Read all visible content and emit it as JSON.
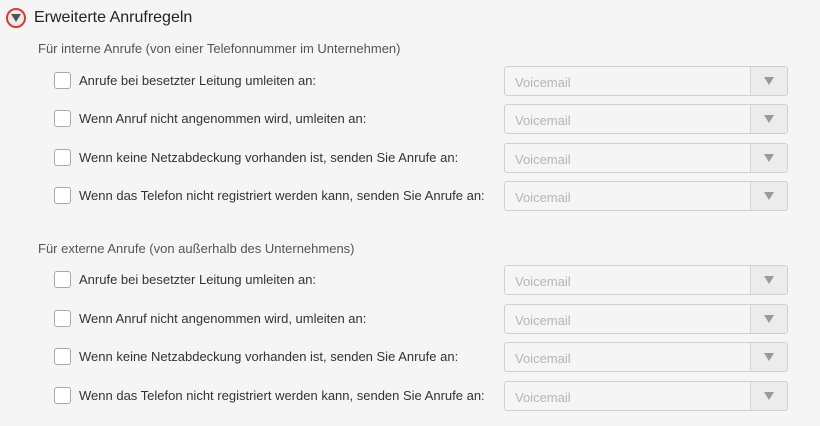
{
  "header": {
    "title": "Erweiterte Anrufregeln",
    "toggle_icon": "triangle-down-icon"
  },
  "internal": {
    "title": "Für interne Anrufe (von einer Telefonnummer im Unternehmen)",
    "rules": [
      {
        "label": "Anrufe bei besetzter Leitung umleiten an:",
        "checked": false,
        "value": "Voicemail"
      },
      {
        "label": "Wenn Anruf nicht angenommen wird, umleiten an:",
        "checked": false,
        "value": "Voicemail"
      },
      {
        "label": "Wenn keine Netzabdeckung vorhanden ist, senden Sie Anrufe an:",
        "checked": false,
        "value": "Voicemail"
      },
      {
        "label": "Wenn das Telefon nicht registriert werden kann, senden Sie Anrufe an:",
        "checked": false,
        "value": "Voicemail"
      }
    ]
  },
  "external": {
    "title": "Für externe Anrufe (von außerhalb des Unternehmens)",
    "rules": [
      {
        "label": "Anrufe bei besetzter Leitung umleiten an:",
        "checked": false,
        "value": "Voicemail"
      },
      {
        "label": "Wenn Anruf nicht angenommen wird, umleiten an:",
        "checked": false,
        "value": "Voicemail"
      },
      {
        "label": "Wenn keine Netzabdeckung vorhanden ist, senden Sie Anrufe an:",
        "checked": false,
        "value": "Voicemail"
      },
      {
        "label": "Wenn das Telefon nicht registriert werden kann, senden Sie Anrufe an:",
        "checked": false,
        "value": "Voicemail"
      }
    ]
  },
  "colors": {
    "toggle_ring": "#e0392b",
    "placeholder_text": "#b5b5b5"
  }
}
